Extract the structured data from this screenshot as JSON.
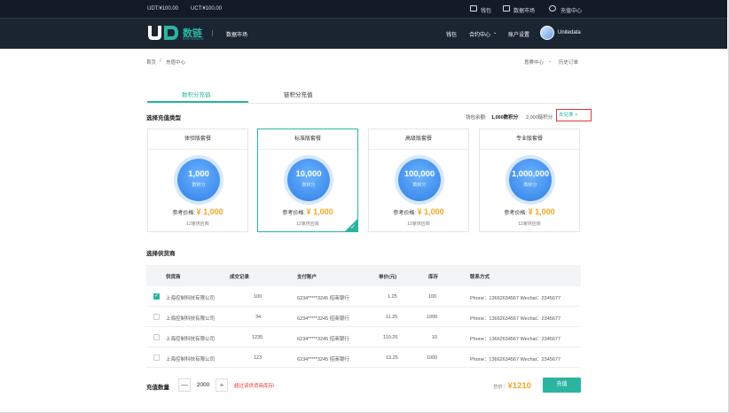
{
  "topbar": {
    "balance_udt": "UDT:¥100.00",
    "balance_uct": "UCT:¥100.00",
    "links": [
      "钱包",
      "数据市场",
      "充值中心"
    ],
    "brand_cn": "数链",
    "brand_en": "UNITEDATA",
    "section": "数据市场",
    "nav": [
      "钱包",
      "合约中心",
      "账户设置"
    ],
    "user": "Unitedata"
  },
  "breadcrumb": {
    "home": "首页",
    "sep": "/",
    "current": "充值中心"
  },
  "right_links": {
    "recharge_center": " ",
    "order_history": "历史订单",
    "center_label": "意赛中心"
  },
  "tabs": [
    {
      "label": "数积分充值",
      "active": true
    },
    {
      "label": "链积分充值",
      "active": false
    }
  ],
  "recharge_type": {
    "title": "选择充值类型",
    "wallet_prefix": "钱包余额:",
    "wallet_points": "1,000数积分",
    "wallet_chain": "2,000链积分",
    "goto_label": "去兑换 >"
  },
  "packages": [
    {
      "name": "体验版套餐",
      "amount": "1,000",
      "unit": "数积分",
      "price_label": "参考价格:",
      "price": "¥ 1,000",
      "suppliers": "12家供应商",
      "selected": false
    },
    {
      "name": "标准版套餐",
      "amount": "10,000",
      "unit": "数积分",
      "price_label": "参考价格:",
      "price": "¥ 1,000",
      "suppliers": "12家供应商",
      "selected": true
    },
    {
      "name": "高级版套餐",
      "amount": "100,000",
      "unit": "数积分",
      "price_label": "参考价格:",
      "price": "¥ 1,000",
      "suppliers": "12家供应商",
      "selected": false
    },
    {
      "name": "专业版套餐",
      "amount": "1,000,000",
      "unit": "数积分",
      "price_label": "参考价格:",
      "price": "¥ 1,000",
      "suppliers": "12家供应商",
      "selected": false
    }
  ],
  "supplier_section": {
    "title": "选择供货商"
  },
  "table": {
    "headers": [
      "供货商",
      "成交记录",
      "支付账户",
      "单价(元)",
      "库存",
      "联系方式"
    ],
    "rows": [
      {
        "checked": true,
        "name": "上海控制科技有限公司",
        "deals": "100",
        "account": "6234*****3245 招商银行",
        "price": "1.25",
        "stock": "100",
        "contact": "Phone：13662634567  Wechat：2345677"
      },
      {
        "checked": false,
        "name": "上海控制科技有限公司",
        "deals": "34",
        "account": "6234*****3245 招商银行",
        "price": "11.25",
        "stock": "1000",
        "contact": "Phone：13662634567  Wechat：2345677"
      },
      {
        "checked": false,
        "name": "上海控制科技有限公司",
        "deals": "1235",
        "account": "6234*****3245 招商银行",
        "price": "110.25",
        "stock": "10",
        "contact": "Phone：13662634567  Wechat：2345677"
      },
      {
        "checked": false,
        "name": "上海控制科技有限公司",
        "deals": "123",
        "account": "6234*****3245 招商银行",
        "price": "13.25",
        "stock": "1000",
        "contact": "Phone：13662634567  Wechat：2345677"
      }
    ]
  },
  "footer": {
    "qty_label": "充值数量",
    "minus": "—",
    "qty": "2000",
    "plus": "+",
    "warning": "超过该供货商库存!",
    "total_label": "总价：",
    "total": "¥1210",
    "submit": "充值"
  },
  "colors": {
    "accent": "#2bb5a1",
    "price": "#f5a623",
    "warn": "#e33333",
    "topbar": "#1b2431"
  }
}
